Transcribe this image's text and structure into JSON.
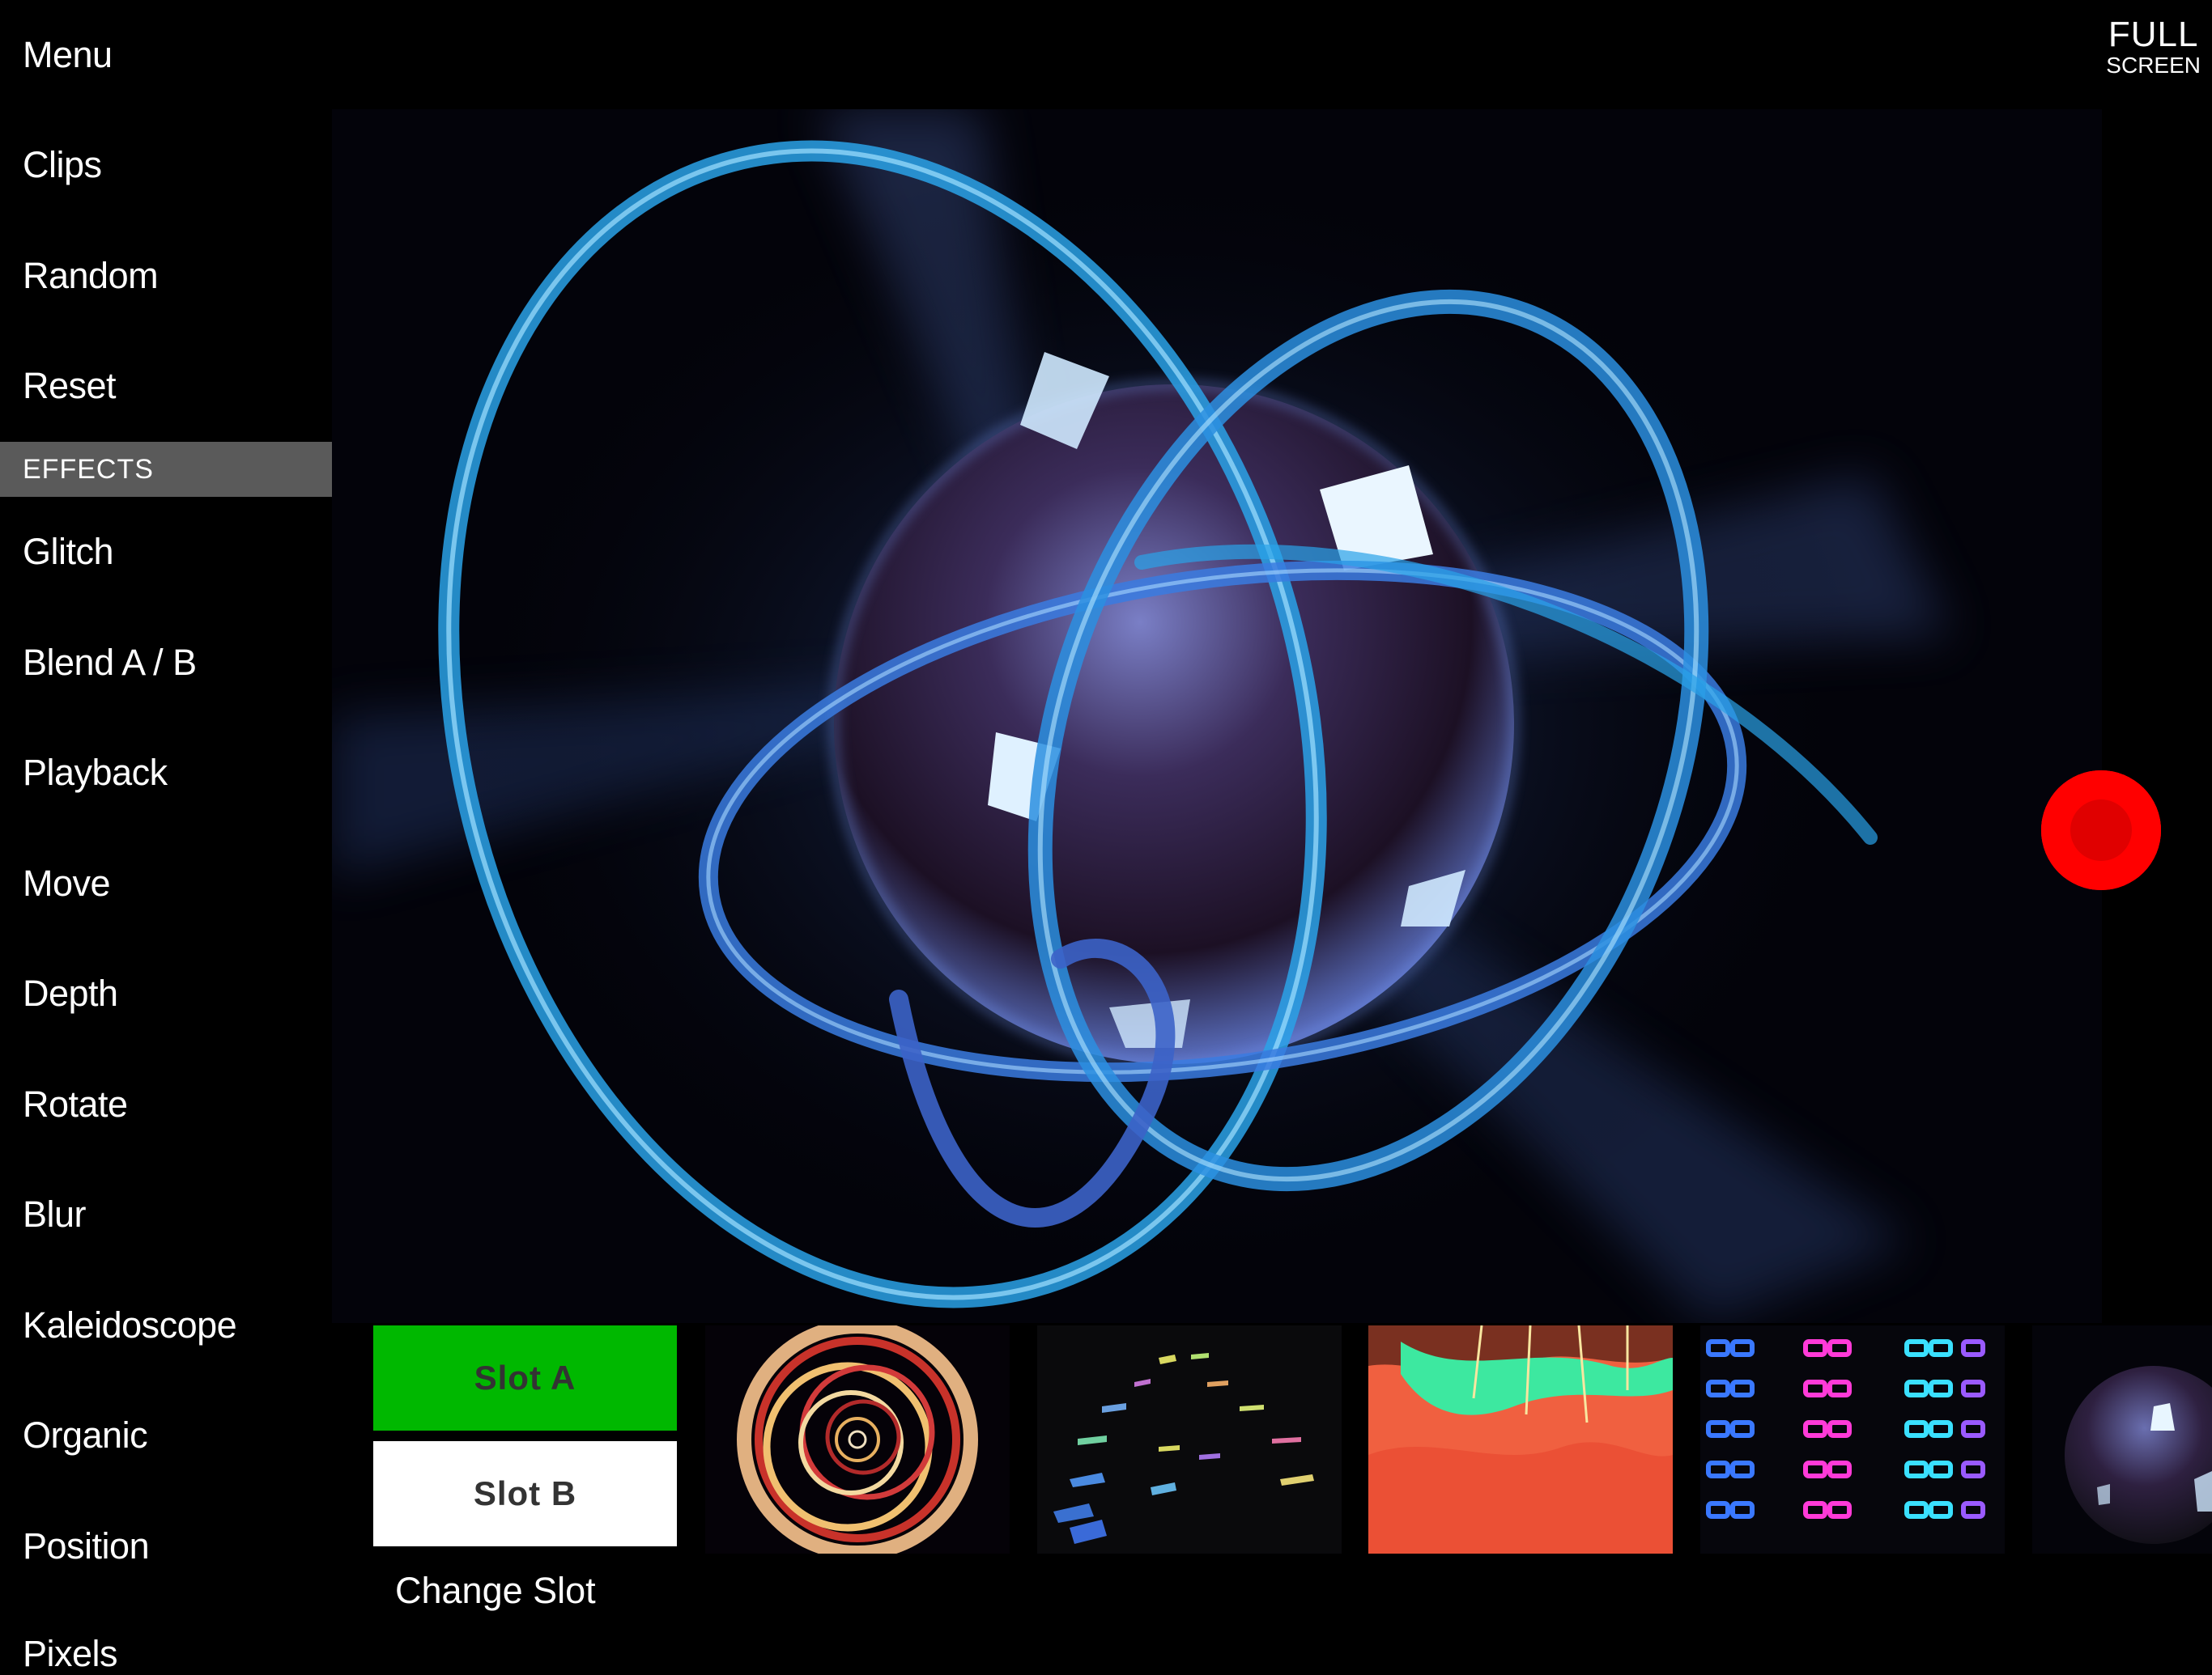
{
  "sidebar": {
    "items": [
      {
        "label": "Menu"
      },
      {
        "label": "Clips"
      },
      {
        "label": "Random"
      },
      {
        "label": "Reset"
      }
    ],
    "section_header": "EFFECTS",
    "effects": [
      {
        "label": "Glitch"
      },
      {
        "label": "Blend A / B"
      },
      {
        "label": "Playback"
      },
      {
        "label": "Move"
      },
      {
        "label": "Depth"
      },
      {
        "label": "Rotate"
      },
      {
        "label": "Blur"
      },
      {
        "label": "Kaleidoscope"
      },
      {
        "label": "Organic"
      },
      {
        "label": "Position"
      },
      {
        "label": "Pixels"
      }
    ]
  },
  "fullscreen": {
    "line1": "FULL",
    "line2": "SCREEN"
  },
  "slots": {
    "slot_a": "Slot A",
    "slot_b": "Slot B",
    "change_slot": "Change Slot",
    "active_color": "#00b800"
  },
  "record_color": "#ff0000",
  "thumbnails": [
    {
      "icon": "spiral-rings-thumbnail"
    },
    {
      "icon": "floating-tiles-thumbnail"
    },
    {
      "icon": "orange-waves-thumbnail"
    },
    {
      "icon": "neon-grid-thumbnail"
    },
    {
      "icon": "sphere-rings-thumbnail"
    }
  ]
}
